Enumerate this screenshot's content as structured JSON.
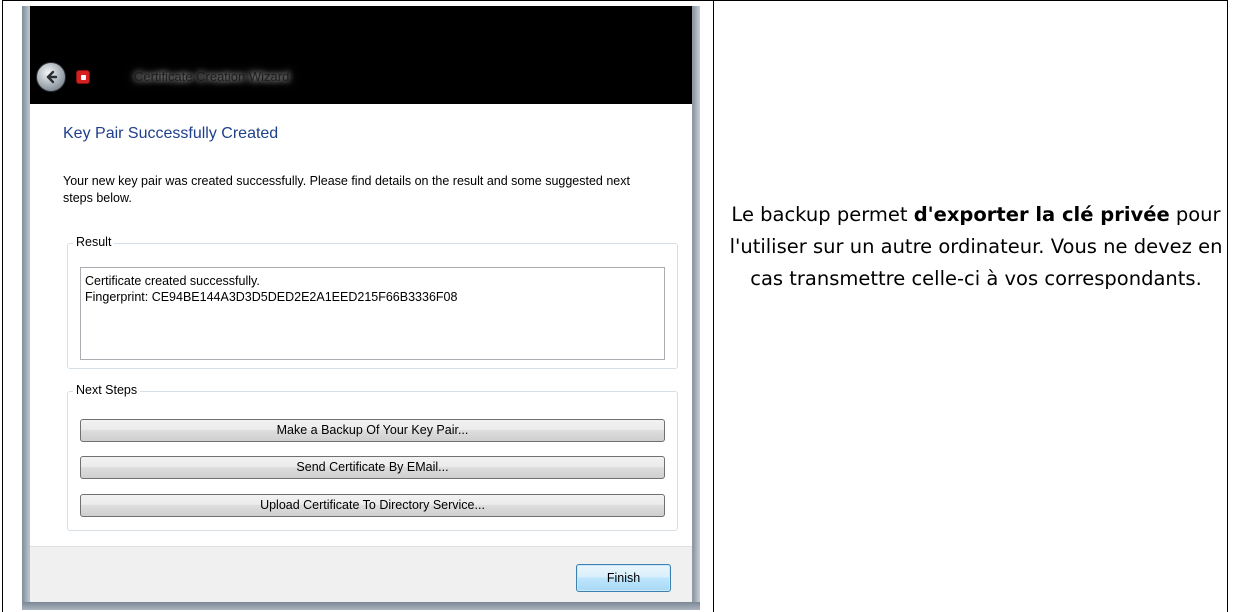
{
  "window": {
    "title": "Certificate Creation Wizard"
  },
  "page": {
    "heading": "Key Pair Successfully Created",
    "intro": "Your new key pair was created successfully. Please find details on the result and some suggested next steps below."
  },
  "result": {
    "label": "Result",
    "line1": "Certificate created successfully.",
    "line2": "Fingerprint: CE94BE144A3D3D5DED2E2A1EED215F66B3336F08"
  },
  "next_steps": {
    "label": "Next Steps",
    "backup_label": "Make a Backup Of Your Key Pair...",
    "email_label": "Send Certificate By EMail...",
    "upload_label": "Upload Certificate To Directory Service..."
  },
  "footer": {
    "finish_label": "Finish"
  },
  "caption": {
    "part1": "Le backup permet ",
    "bold1": "d'exporter la clé privée",
    "part2": " pour l'utiliser sur un autre ordinateur. Vous ne devez en cas transmettre celle-ci à vos correspondants."
  },
  "colors": {
    "heading": "#1e3f8a",
    "titlebar": "#000000",
    "finish_border": "#3c7fb1"
  },
  "icons": [
    "back-arrow-icon",
    "app-icon"
  ]
}
